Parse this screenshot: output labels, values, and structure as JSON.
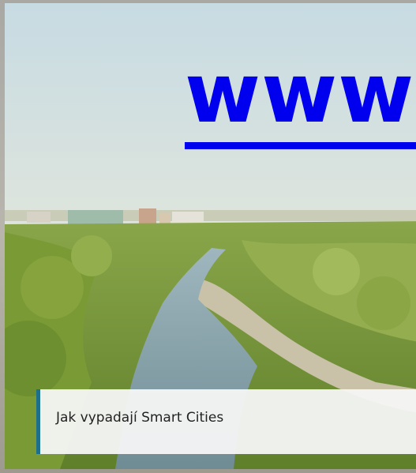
{
  "link": {
    "text": "www"
  },
  "caption": {
    "text": "Jak vypadají Smart Cities"
  },
  "colors": {
    "link": "#0000ee",
    "caption_accent": "#1d6f8a",
    "caption_background": "#f6f6f6",
    "caption_text": "#222222"
  }
}
